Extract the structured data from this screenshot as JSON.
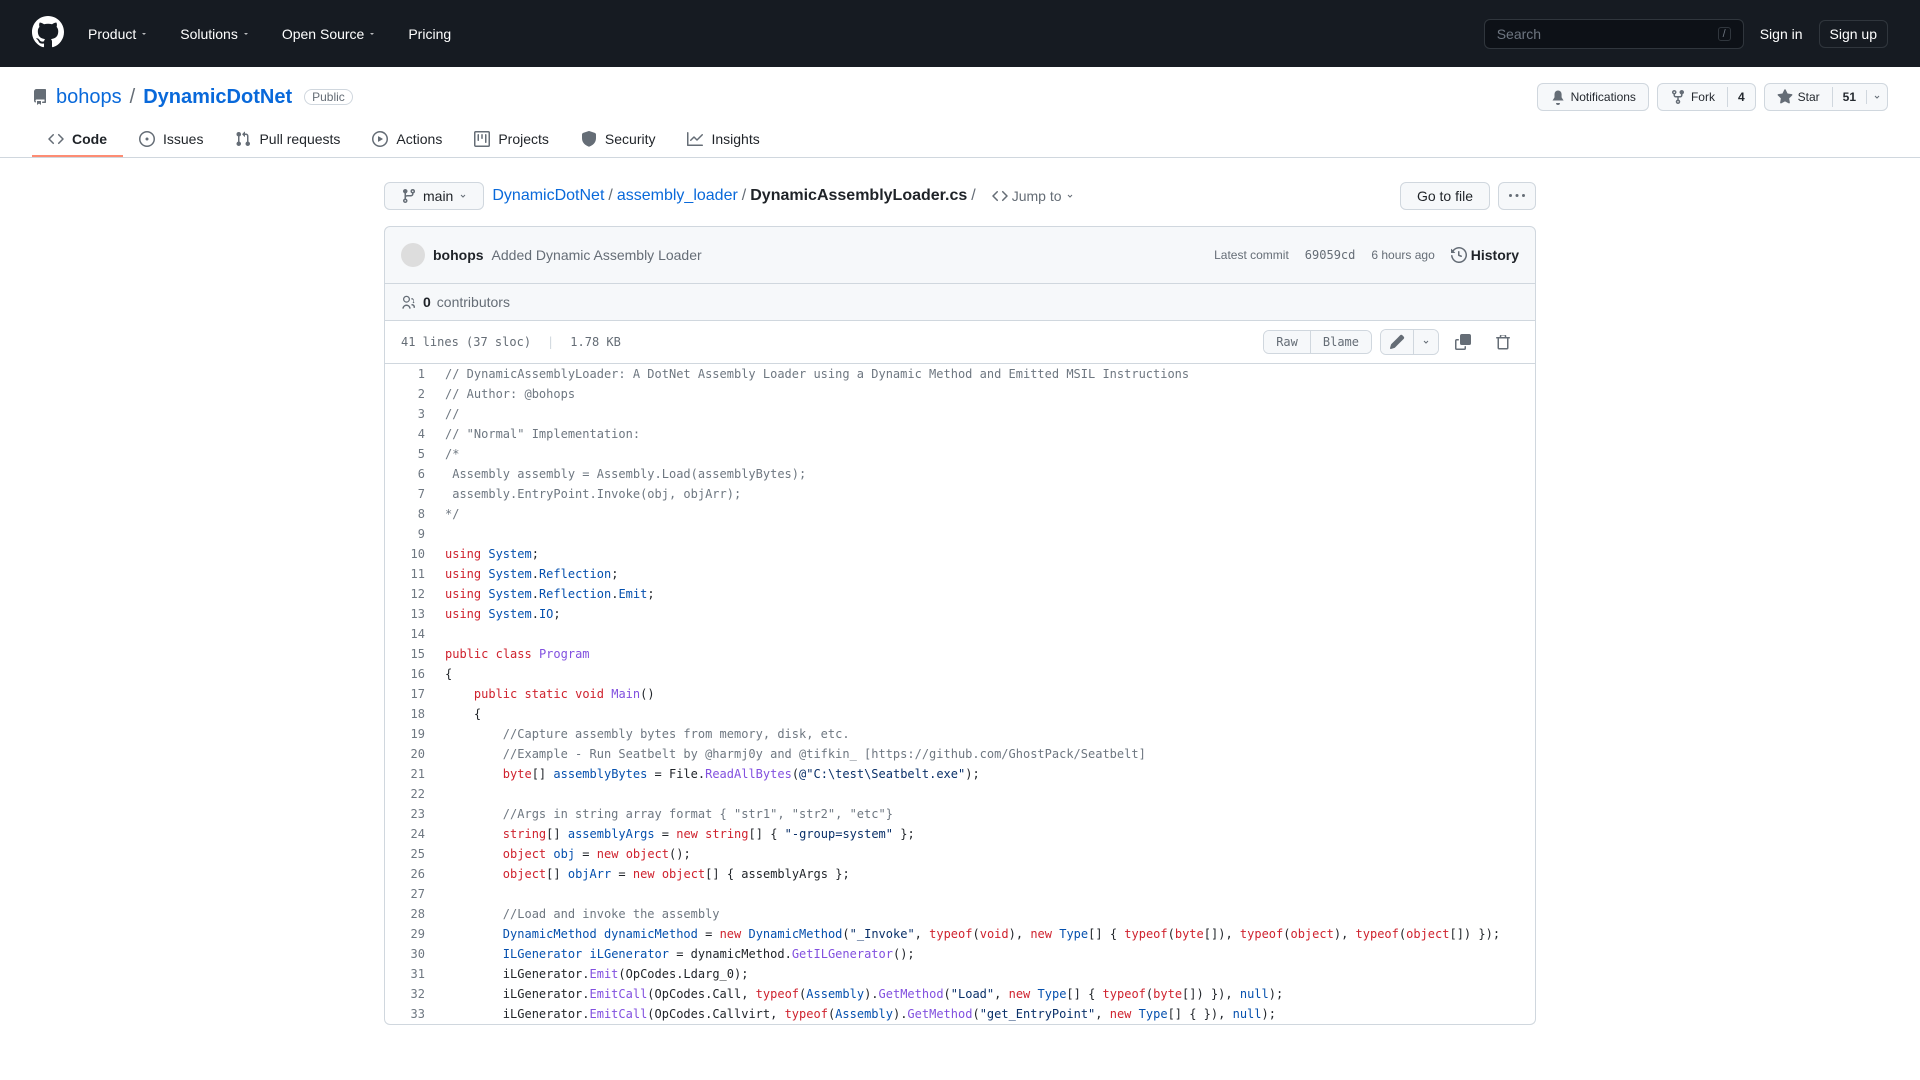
{
  "header": {
    "nav": [
      "Product",
      "Solutions",
      "Open Source",
      "Pricing"
    ],
    "search_placeholder": "Search",
    "slash": "/",
    "signin": "Sign in",
    "signup": "Sign up"
  },
  "repo": {
    "owner": "bohops",
    "name": "DynamicDotNet",
    "visibility": "Public",
    "notifications_label": "Notifications",
    "fork_label": "Fork",
    "fork_count": "4",
    "star_label": "Star",
    "star_count": "51"
  },
  "tabs": [
    "Code",
    "Issues",
    "Pull requests",
    "Actions",
    "Projects",
    "Security",
    "Insights"
  ],
  "file_nav": {
    "branch": "main",
    "breadcrumb": [
      "DynamicDotNet",
      "assembly_loader",
      "DynamicAssemblyLoader.cs"
    ],
    "jump_to": "Jump to",
    "go_to_file": "Go to file"
  },
  "commit": {
    "author": "bohops",
    "message": "Added Dynamic Assembly Loader",
    "latest_commit_label": "Latest commit",
    "sha": "69059cd",
    "time": "6 hours ago",
    "history_label": "History",
    "contributors_count": "0",
    "contributors_label": "contributors"
  },
  "file_head": {
    "lines_info": "41 lines (37 sloc)",
    "size": "1.78 KB",
    "raw": "Raw",
    "blame": "Blame"
  },
  "code": [
    {
      "n": 1,
      "tokens": [
        {
          "c": "c-com",
          "t": "// DynamicAssemblyLoader: A DotNet Assembly Loader using a Dynamic Method and Emitted MSIL Instructions"
        }
      ]
    },
    {
      "n": 2,
      "tokens": [
        {
          "c": "c-com",
          "t": "// Author: @bohops"
        }
      ]
    },
    {
      "n": 3,
      "tokens": [
        {
          "c": "c-com",
          "t": "//"
        }
      ]
    },
    {
      "n": 4,
      "tokens": [
        {
          "c": "c-com",
          "t": "// \"Normal\" Implementation:"
        }
      ]
    },
    {
      "n": 5,
      "tokens": [
        {
          "c": "c-com",
          "t": "/*"
        }
      ]
    },
    {
      "n": 6,
      "tokens": [
        {
          "c": "c-com",
          "t": " Assembly assembly = Assembly.Load(assemblyBytes);"
        }
      ]
    },
    {
      "n": 7,
      "tokens": [
        {
          "c": "c-com",
          "t": " assembly.EntryPoint.Invoke(obj, objArr);"
        }
      ]
    },
    {
      "n": 8,
      "tokens": [
        {
          "c": "c-com",
          "t": "*/"
        }
      ]
    },
    {
      "n": 9,
      "tokens": []
    },
    {
      "n": 10,
      "tokens": [
        {
          "c": "c-key",
          "t": "using"
        },
        {
          "t": " "
        },
        {
          "c": "c-type",
          "t": "System"
        },
        {
          "t": ";"
        }
      ]
    },
    {
      "n": 11,
      "tokens": [
        {
          "c": "c-key",
          "t": "using"
        },
        {
          "t": " "
        },
        {
          "c": "c-type",
          "t": "System"
        },
        {
          "t": "."
        },
        {
          "c": "c-type",
          "t": "Reflection"
        },
        {
          "t": ";"
        }
      ]
    },
    {
      "n": 12,
      "tokens": [
        {
          "c": "c-key",
          "t": "using"
        },
        {
          "t": " "
        },
        {
          "c": "c-type",
          "t": "System"
        },
        {
          "t": "."
        },
        {
          "c": "c-type",
          "t": "Reflection"
        },
        {
          "t": "."
        },
        {
          "c": "c-type",
          "t": "Emit"
        },
        {
          "t": ";"
        }
      ]
    },
    {
      "n": 13,
      "tokens": [
        {
          "c": "c-key",
          "t": "using"
        },
        {
          "t": " "
        },
        {
          "c": "c-type",
          "t": "System"
        },
        {
          "t": "."
        },
        {
          "c": "c-type",
          "t": "IO"
        },
        {
          "t": ";"
        }
      ]
    },
    {
      "n": 14,
      "tokens": []
    },
    {
      "n": 15,
      "tokens": [
        {
          "c": "c-key",
          "t": "public"
        },
        {
          "t": " "
        },
        {
          "c": "c-key",
          "t": "class"
        },
        {
          "t": " "
        },
        {
          "c": "c-fn",
          "t": "Program"
        }
      ]
    },
    {
      "n": 16,
      "tokens": [
        {
          "t": "{"
        }
      ]
    },
    {
      "n": 17,
      "tokens": [
        {
          "t": "    "
        },
        {
          "c": "c-key",
          "t": "public"
        },
        {
          "t": " "
        },
        {
          "c": "c-key",
          "t": "static"
        },
        {
          "t": " "
        },
        {
          "c": "c-key",
          "t": "void"
        },
        {
          "t": " "
        },
        {
          "c": "c-fn",
          "t": "Main"
        },
        {
          "t": "()"
        }
      ]
    },
    {
      "n": 18,
      "tokens": [
        {
          "t": "    {"
        }
      ]
    },
    {
      "n": 19,
      "tokens": [
        {
          "t": "        "
        },
        {
          "c": "c-com",
          "t": "//Capture assembly bytes from memory, disk, etc."
        }
      ]
    },
    {
      "n": 20,
      "tokens": [
        {
          "t": "        "
        },
        {
          "c": "c-com",
          "t": "//Example - Run Seatbelt by @harmj0y and @tifkin_ [https://github.com/GhostPack/Seatbelt]"
        }
      ]
    },
    {
      "n": 21,
      "tokens": [
        {
          "t": "        "
        },
        {
          "c": "c-key",
          "t": "byte"
        },
        {
          "t": "[] "
        },
        {
          "c": "c-type",
          "t": "assemblyBytes"
        },
        {
          "t": " = File."
        },
        {
          "c": "c-fn",
          "t": "ReadAllBytes"
        },
        {
          "t": "("
        },
        {
          "c": "c-str",
          "t": "@\"C:\\test\\Seatbelt.exe\""
        },
        {
          "t": ");"
        }
      ]
    },
    {
      "n": 22,
      "tokens": []
    },
    {
      "n": 23,
      "tokens": [
        {
          "t": "        "
        },
        {
          "c": "c-com",
          "t": "//Args in string array format { \"str1\", \"str2\", \"etc\"}"
        }
      ]
    },
    {
      "n": 24,
      "tokens": [
        {
          "t": "        "
        },
        {
          "c": "c-key",
          "t": "string"
        },
        {
          "t": "[] "
        },
        {
          "c": "c-type",
          "t": "assemblyArgs"
        },
        {
          "t": " = "
        },
        {
          "c": "c-key",
          "t": "new"
        },
        {
          "t": " "
        },
        {
          "c": "c-key",
          "t": "string"
        },
        {
          "t": "[] { "
        },
        {
          "c": "c-str",
          "t": "\"-group=system\""
        },
        {
          "t": " };"
        }
      ]
    },
    {
      "n": 25,
      "tokens": [
        {
          "t": "        "
        },
        {
          "c": "c-key",
          "t": "object"
        },
        {
          "t": " "
        },
        {
          "c": "c-type",
          "t": "obj"
        },
        {
          "t": " = "
        },
        {
          "c": "c-key",
          "t": "new"
        },
        {
          "t": " "
        },
        {
          "c": "c-key",
          "t": "object"
        },
        {
          "t": "();"
        }
      ]
    },
    {
      "n": 26,
      "tokens": [
        {
          "t": "        "
        },
        {
          "c": "c-key",
          "t": "object"
        },
        {
          "t": "[] "
        },
        {
          "c": "c-type",
          "t": "objArr"
        },
        {
          "t": " = "
        },
        {
          "c": "c-key",
          "t": "new"
        },
        {
          "t": " "
        },
        {
          "c": "c-key",
          "t": "object"
        },
        {
          "t": "[] { assemblyArgs };"
        }
      ]
    },
    {
      "n": 27,
      "tokens": []
    },
    {
      "n": 28,
      "tokens": [
        {
          "t": "        "
        },
        {
          "c": "c-com",
          "t": "//Load and invoke the assembly"
        }
      ]
    },
    {
      "n": 29,
      "tokens": [
        {
          "t": "        "
        },
        {
          "c": "c-type",
          "t": "DynamicMethod"
        },
        {
          "t": " "
        },
        {
          "c": "c-type",
          "t": "dynamicMethod"
        },
        {
          "t": " = "
        },
        {
          "c": "c-key",
          "t": "new"
        },
        {
          "t": " "
        },
        {
          "c": "c-type",
          "t": "DynamicMethod"
        },
        {
          "t": "("
        },
        {
          "c": "c-str",
          "t": "\"_Invoke\""
        },
        {
          "t": ", "
        },
        {
          "c": "c-key",
          "t": "typeof"
        },
        {
          "t": "("
        },
        {
          "c": "c-key",
          "t": "void"
        },
        {
          "t": "), "
        },
        {
          "c": "c-key",
          "t": "new"
        },
        {
          "t": " "
        },
        {
          "c": "c-type",
          "t": "Type"
        },
        {
          "t": "[] { "
        },
        {
          "c": "c-key",
          "t": "typeof"
        },
        {
          "t": "("
        },
        {
          "c": "c-key",
          "t": "byte"
        },
        {
          "t": "[]), "
        },
        {
          "c": "c-key",
          "t": "typeof"
        },
        {
          "t": "("
        },
        {
          "c": "c-key",
          "t": "object"
        },
        {
          "t": "), "
        },
        {
          "c": "c-key",
          "t": "typeof"
        },
        {
          "t": "("
        },
        {
          "c": "c-key",
          "t": "object"
        },
        {
          "t": "[]) });"
        }
      ]
    },
    {
      "n": 30,
      "tokens": [
        {
          "t": "        "
        },
        {
          "c": "c-type",
          "t": "ILGenerator"
        },
        {
          "t": " "
        },
        {
          "c": "c-type",
          "t": "iLGenerator"
        },
        {
          "t": " = dynamicMethod."
        },
        {
          "c": "c-fn",
          "t": "GetILGenerator"
        },
        {
          "t": "();"
        }
      ]
    },
    {
      "n": 31,
      "tokens": [
        {
          "t": "        iLGenerator."
        },
        {
          "c": "c-fn",
          "t": "Emit"
        },
        {
          "t": "(OpCodes.Ldarg_0);"
        }
      ]
    },
    {
      "n": 32,
      "tokens": [
        {
          "t": "        iLGenerator."
        },
        {
          "c": "c-fn",
          "t": "EmitCall"
        },
        {
          "t": "(OpCodes.Call, "
        },
        {
          "c": "c-key",
          "t": "typeof"
        },
        {
          "t": "("
        },
        {
          "c": "c-type",
          "t": "Assembly"
        },
        {
          "t": ")."
        },
        {
          "c": "c-fn",
          "t": "GetMethod"
        },
        {
          "t": "("
        },
        {
          "c": "c-str",
          "t": "\"Load\""
        },
        {
          "t": ", "
        },
        {
          "c": "c-key",
          "t": "new"
        },
        {
          "t": " "
        },
        {
          "c": "c-type",
          "t": "Type"
        },
        {
          "t": "[] { "
        },
        {
          "c": "c-key",
          "t": "typeof"
        },
        {
          "t": "("
        },
        {
          "c": "c-key",
          "t": "byte"
        },
        {
          "t": "[]) }), "
        },
        {
          "c": "c-type",
          "t": "null"
        },
        {
          "t": ");"
        }
      ]
    },
    {
      "n": 33,
      "tokens": [
        {
          "t": "        iLGenerator."
        },
        {
          "c": "c-fn",
          "t": "EmitCall"
        },
        {
          "t": "(OpCodes.Callvirt, "
        },
        {
          "c": "c-key",
          "t": "typeof"
        },
        {
          "t": "("
        },
        {
          "c": "c-type",
          "t": "Assembly"
        },
        {
          "t": ")."
        },
        {
          "c": "c-fn",
          "t": "GetMethod"
        },
        {
          "t": "("
        },
        {
          "c": "c-str",
          "t": "\"get_EntryPoint\""
        },
        {
          "t": ", "
        },
        {
          "c": "c-key",
          "t": "new"
        },
        {
          "t": " "
        },
        {
          "c": "c-type",
          "t": "Type"
        },
        {
          "t": "[] { }), "
        },
        {
          "c": "c-type",
          "t": "null"
        },
        {
          "t": ");"
        }
      ]
    }
  ]
}
